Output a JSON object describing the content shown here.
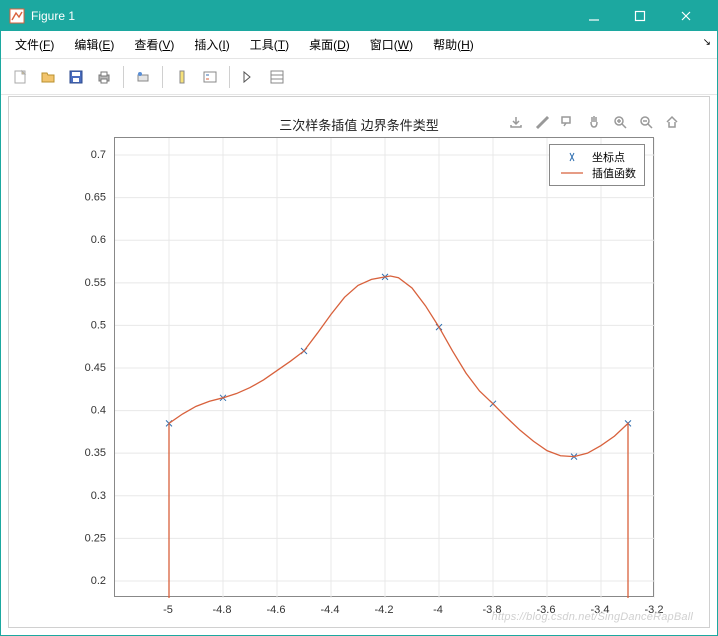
{
  "window": {
    "title": "Figure 1"
  },
  "menubar": {
    "items": [
      {
        "pre": "文件(",
        "ul": "F",
        "post": ")"
      },
      {
        "pre": "编辑(",
        "ul": "E",
        "post": ")"
      },
      {
        "pre": "查看(",
        "ul": "V",
        "post": ")"
      },
      {
        "pre": "插入(",
        "ul": "I",
        "post": ")"
      },
      {
        "pre": "工具(",
        "ul": "T",
        "post": ")"
      },
      {
        "pre": "桌面(",
        "ul": "D",
        "post": ")"
      },
      {
        "pre": "窗口(",
        "ul": "W",
        "post": ")"
      },
      {
        "pre": "帮助(",
        "ul": "H",
        "post": ")"
      }
    ]
  },
  "legend": {
    "points": "坐标点",
    "curve": "插值函数"
  },
  "chart_data": {
    "type": "line",
    "title": "三次样条插值 边界条件类型",
    "xlabel": "",
    "ylabel": "",
    "xlim": [
      -5.2,
      -3.2
    ],
    "ylim": [
      0.18,
      0.72
    ],
    "xticks": [
      -5,
      -4.8,
      -4.6,
      -4.4,
      -4.2,
      -4,
      -3.8,
      -3.6,
      -3.4,
      -3.2
    ],
    "yticks": [
      0.2,
      0.25,
      0.3,
      0.35,
      0.4,
      0.45,
      0.5,
      0.55,
      0.6,
      0.65,
      0.7
    ],
    "series": [
      {
        "name": "坐标点",
        "type": "scatter",
        "marker": "x",
        "color": "#2f6fb0",
        "x": [
          -5,
          -4.8,
          -4.5,
          -4.2,
          -4,
          -3.8,
          -3.5,
          -3.3
        ],
        "y": [
          0.385,
          0.415,
          0.47,
          0.557,
          0.498,
          0.408,
          0.346,
          0.385
        ]
      },
      {
        "name": "插值函数",
        "type": "line",
        "color": "#d8613c",
        "x": [
          -5,
          -5,
          -4.95,
          -4.9,
          -4.85,
          -4.8,
          -4.75,
          -4.7,
          -4.65,
          -4.6,
          -4.55,
          -4.5,
          -4.45,
          -4.4,
          -4.35,
          -4.3,
          -4.25,
          -4.2,
          -4.18,
          -4.15,
          -4.1,
          -4.05,
          -4,
          -3.95,
          -3.9,
          -3.85,
          -3.8,
          -3.75,
          -3.7,
          -3.65,
          -3.6,
          -3.55,
          -3.5,
          -3.45,
          -3.4,
          -3.35,
          -3.3,
          -3.3
        ],
        "y": [
          0.18,
          0.385,
          0.396,
          0.405,
          0.411,
          0.415,
          0.42,
          0.427,
          0.436,
          0.447,
          0.458,
          0.47,
          0.491,
          0.513,
          0.533,
          0.547,
          0.554,
          0.557,
          0.558,
          0.556,
          0.544,
          0.523,
          0.498,
          0.47,
          0.444,
          0.423,
          0.408,
          0.392,
          0.377,
          0.364,
          0.353,
          0.347,
          0.346,
          0.35,
          0.359,
          0.37,
          0.385,
          0.18
        ]
      }
    ]
  },
  "watermark": "https://blog.csdn.net/SingDanceRapBall"
}
